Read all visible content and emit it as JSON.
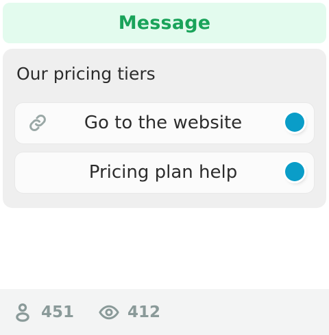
{
  "header": {
    "title": "Message",
    "accent_color": "#1aa35a",
    "background_color": "#e3fbee"
  },
  "card": {
    "title": "Our pricing tiers",
    "options": [
      {
        "label": "Go to the website",
        "icon": "link-icon",
        "dot_color": "#0a9dc8"
      },
      {
        "label": "Pricing plan help",
        "icon": "",
        "dot_color": "#0a9dc8"
      }
    ]
  },
  "footer": {
    "users_icon": "user-icon",
    "users_count": "451",
    "views_icon": "eye-icon",
    "views_count": "412"
  }
}
